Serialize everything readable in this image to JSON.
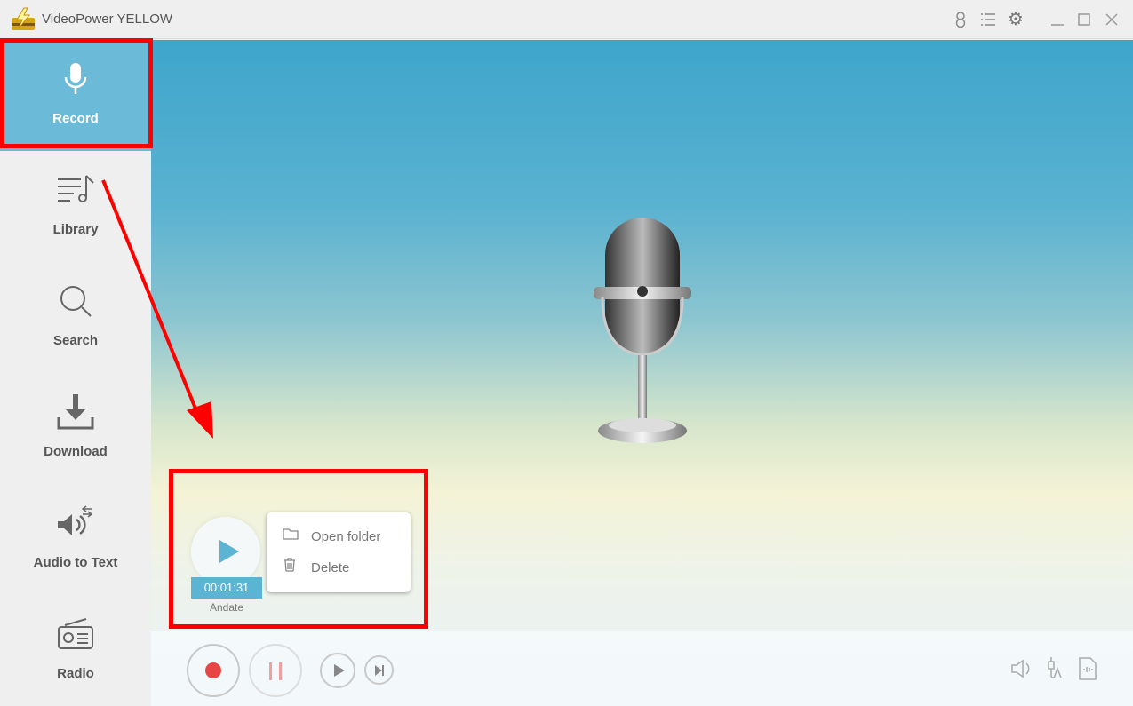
{
  "window": {
    "title": "VideoPower YELLOW"
  },
  "titlebar_icons": [
    "user-icon",
    "list-icon",
    "gear-icon",
    "minimize-icon",
    "maximize-icon",
    "close-icon"
  ],
  "sidebar": {
    "items": [
      {
        "label": "Record",
        "icon": "microphone-icon",
        "active": true
      },
      {
        "label": "Library",
        "icon": "music-list-icon"
      },
      {
        "label": "Search",
        "icon": "search-icon"
      },
      {
        "label": "Download",
        "icon": "download-icon"
      },
      {
        "label": "Audio to Text",
        "icon": "speaker-convert-icon"
      },
      {
        "label": "Radio",
        "icon": "radio-icon"
      }
    ]
  },
  "recording": {
    "duration": "00:01:31",
    "name": "Andate"
  },
  "context_menu": {
    "items": [
      {
        "label": "Open folder",
        "icon": "folder-icon"
      },
      {
        "label": "Delete",
        "icon": "trash-icon"
      }
    ]
  },
  "controls": [
    "record",
    "pause",
    "play",
    "next"
  ],
  "right_icons": [
    "volume-icon",
    "audio-jack-icon",
    "audio-file-icon"
  ],
  "colors": {
    "accent": "#5bb4d4",
    "active_nav": "#6bbbd8",
    "record": "#e84545",
    "annotation": "#ff0000"
  }
}
